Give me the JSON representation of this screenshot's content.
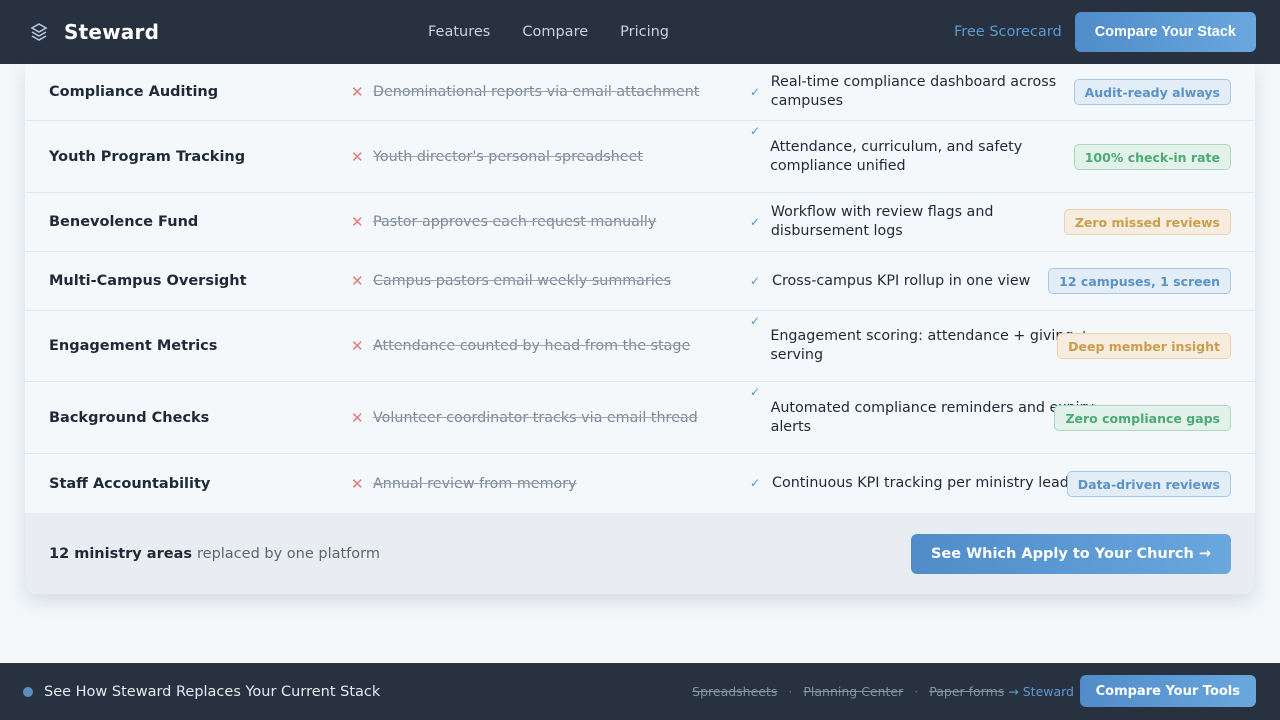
{
  "nav": {
    "brand": "Steward",
    "links": [
      "Features",
      "Compare",
      "Pricing"
    ],
    "free_link": "Free Scorecard",
    "cta": "Compare Your Stack"
  },
  "rows": [
    {
      "area": "Compliance Auditing",
      "old": "Denominational reports via email attachment",
      "new": "Real-time compliance dashboard across campuses",
      "badge": "Audit-ready always",
      "badge_color": "blue"
    },
    {
      "area": "Youth Program Tracking",
      "old": "Youth director's personal spreadsheet",
      "new": "Attendance, curriculum, and safety compliance unified",
      "badge": "100% check-in rate",
      "badge_color": "green"
    },
    {
      "area": "Benevolence Fund",
      "old": "Pastor approves each request manually",
      "new": "Workflow with review flags and disbursement logs",
      "badge": "Zero missed reviews",
      "badge_color": "amber"
    },
    {
      "area": "Multi-Campus Oversight",
      "old": "Campus pastors email weekly summaries",
      "new": "Cross-campus KPI rollup in one view",
      "badge": "12 campuses, 1 screen",
      "badge_color": "blue"
    },
    {
      "area": "Engagement Metrics",
      "old": "Attendance counted by head from the stage",
      "new": "Engagement scoring: attendance + giving + serving",
      "badge": "Deep member insight",
      "badge_color": "amber"
    },
    {
      "area": "Background Checks",
      "old": "Volunteer coordinator tracks via email thread",
      "new": "Automated compliance reminders and expiry alerts",
      "badge": "Zero compliance gaps",
      "badge_color": "green"
    },
    {
      "area": "Staff Accountability",
      "old": "Annual review from memory",
      "new": "Continuous KPI tracking per ministry leader",
      "badge": "Data-driven reviews",
      "badge_color": "blue"
    }
  ],
  "footer": {
    "count_bold": "12 ministry areas",
    "count_rest": "replaced by one platform",
    "cta": "See Which Apply to Your Church →"
  },
  "bar": {
    "text": "See How Steward Replaces Your Current Stack",
    "stack_old": [
      "Spreadsheets",
      "Planning Center",
      "Paper forms"
    ],
    "stack_new": "→ Steward",
    "cta": "Compare Your Tools"
  },
  "icons": {
    "brand": "stacked-layers-icon",
    "old": "x-icon",
    "new": "check-icon",
    "bar_dot": "status-dot-icon"
  },
  "colors": {
    "nav_bg": "#27313f",
    "accent": "#5b9bd5",
    "x_mark": "#e17c7c",
    "badge_blue": "#5b92c7",
    "badge_green": "#4caa74",
    "badge_amber": "#cc9d4a"
  }
}
